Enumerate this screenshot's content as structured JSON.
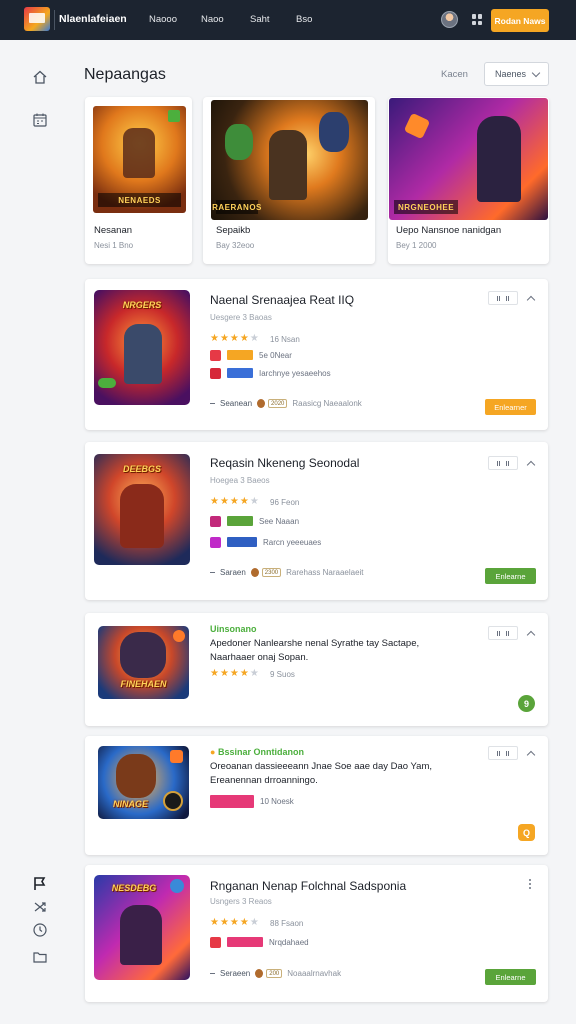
{
  "topbar": {
    "brand": "Nlaenlafeiaen",
    "nav": [
      "Naooo",
      "Naoo",
      "Saht",
      "Bso"
    ],
    "cta": "Rodan Naws"
  },
  "header": {
    "title": "Nepaangas",
    "sort_label": "Kacen",
    "sort_value": "Naenes"
  },
  "featured": [
    {
      "title": "Nesanan",
      "sub": "Nesi 1 Bno",
      "banner": "NENAEDS"
    },
    {
      "title": "Sepaikb",
      "sub": "Bay 32eoo",
      "banner": "RAERANOS"
    },
    {
      "title": "Uepo Nansnoe nanidgan",
      "sub": "Bey 1 2000",
      "banner": "NRGNEOHEE"
    }
  ],
  "items": [
    {
      "title": "Naenal Srenaajea Reat IIQ",
      "sub": "Uesgere 3 Baoas",
      "stars": 4,
      "rating_text": "16 Nsan",
      "tag1": "5e 0Near",
      "tag2": "Iarchnye yesaeehos",
      "footer_name": "Seanean",
      "footer_badge": "2020",
      "footer_text": "Raasicg Naeaalonk",
      "button": "Enlearner",
      "thumb_caption": "NRGERS",
      "accent": "#f5a623"
    },
    {
      "title": "Reqasin Nkeneng Seonodal",
      "sub": "Hoegea 3 Baeos",
      "stars": 4,
      "rating_text": "96 Feon",
      "tag1": "See Naaan",
      "tag2": "Rarcn yeeeuaes",
      "footer_name": "Saraen",
      "footer_badge": "2300",
      "footer_text": "Rarehass Naraaelaeit",
      "button": "Enlearne",
      "thumb_caption": "DEEBGS",
      "accent": "#5aa43a"
    },
    {
      "heading": "Uinsonano",
      "desc1": "Apedoner Nanlearshe nenal Syrathe tay Sactape,",
      "desc2": "Naarhaaer onaj Sopan.",
      "stars": 4,
      "rating_text": "9 Suos",
      "thumb_caption": "FINEHAEN",
      "badge": "9",
      "accent": "#5aa43a"
    },
    {
      "heading": "Bssinar Onntidanon",
      "desc1": "Oreoanan dassieeeann Jnae Soe aae day Dao Yam,",
      "desc2": "Ereanennan drroanningo.",
      "tag": "10 Noesk",
      "thumb_caption": "NINAGE",
      "badge": "Q",
      "accent": "#f5a623"
    },
    {
      "title": "Rnganan Nenap Folchnal Sadsponia",
      "sub": "Usngers 3 Reaos",
      "stars": 4,
      "rating_text": "88 Fsaon",
      "tag2": "Nrqdahaed",
      "footer_name": "Seraeen",
      "footer_badge": "200",
      "footer_text": "Noaaalrnavhak",
      "button": "Enlearne",
      "thumb_caption": "NESDEBG",
      "accent": "#5aa43a"
    }
  ],
  "colors": {
    "topbar": "#1c2430",
    "orange": "#f5a623",
    "green": "#5aa43a",
    "page_bg": "#f4f5f7"
  },
  "icons": [
    "home-icon",
    "calendar-icon",
    "flag-icon",
    "shuffle-icon",
    "clock-icon",
    "folder-icon"
  ]
}
